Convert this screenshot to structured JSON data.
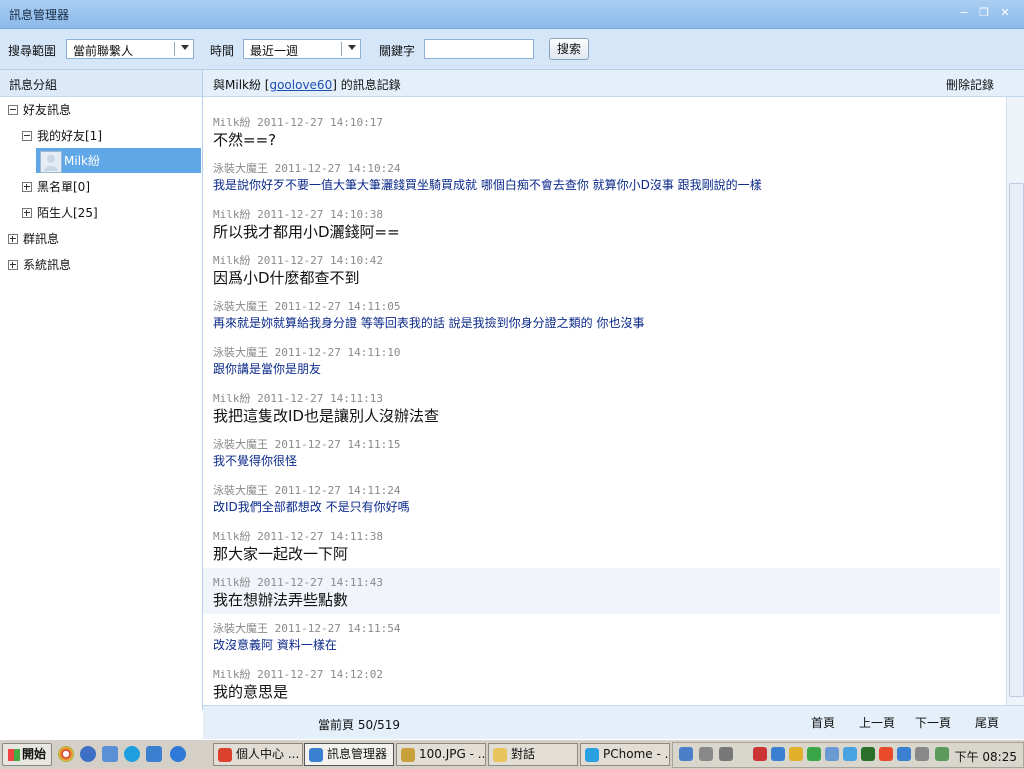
{
  "window": {
    "title": "訊息管理器",
    "minimize_glyph": "−",
    "restore_glyph": "❐",
    "close_glyph": "✕"
  },
  "toolbar": {
    "scope_label": "搜尋範圍",
    "scope_value": "當前聯繫人",
    "time_label": "時間",
    "time_value": "最近一週",
    "keyword_label": "關鍵字",
    "keyword_value": "",
    "search_button": "搜索"
  },
  "sidebar": {
    "header": "訊息分組",
    "items": [
      {
        "label": "好友訊息",
        "expanded": true
      },
      {
        "label": "我的好友[1]",
        "expanded": true
      },
      {
        "label": "Milk紛",
        "selected": true
      },
      {
        "label": "黑名單[0]",
        "expanded": false
      },
      {
        "label": "陌生人[25]",
        "expanded": false
      },
      {
        "label": "群訊息",
        "expanded": false
      },
      {
        "label": "系統訊息",
        "expanded": false
      }
    ]
  },
  "main": {
    "header_prefix": "與Milk紛 [",
    "header_link": "goolove60",
    "header_suffix": "] 的訊息記錄",
    "delete_label": "刪除記錄"
  },
  "messages": [
    {
      "sender": "Milk紛",
      "time": "2011-12-27 14:10:17",
      "text": "不然==?",
      "style": "big"
    },
    {
      "sender": "泳裝大魔王",
      "time": "2011-12-27 14:10:24",
      "text": "我是說你好歹不要一值大筆大筆灑錢買坐騎買成就 哪個白痴不會去查你 就算你小D沒事 跟我剛說的一樣",
      "style": "small"
    },
    {
      "sender": "Milk紛",
      "time": "2011-12-27 14:10:38",
      "text": "所以我才都用小D灑錢阿==",
      "style": "big"
    },
    {
      "sender": "Milk紛",
      "time": "2011-12-27 14:10:42",
      "text": "因爲小D什麽都查不到",
      "style": "big"
    },
    {
      "sender": "泳裝大魔王",
      "time": "2011-12-27 14:11:05",
      "text": "再來就是妳就算給我身分證 等等回表我的話 說是我撿到你身分證之類的 你也沒事",
      "style": "small"
    },
    {
      "sender": "泳裝大魔王",
      "time": "2011-12-27 14:11:10",
      "text": "跟你講是當你是朋友",
      "style": "small"
    },
    {
      "sender": "Milk紛",
      "time": "2011-12-27 14:11:13",
      "text": "我把這隻改ID也是讓別人沒辦法查",
      "style": "big"
    },
    {
      "sender": "泳裝大魔王",
      "time": "2011-12-27 14:11:15",
      "text": "我不覺得你很怪",
      "style": "small"
    },
    {
      "sender": "泳裝大魔王",
      "time": "2011-12-27 14:11:24",
      "text": "改ID我們全部都想改 不是只有你好嗎",
      "style": "small"
    },
    {
      "sender": "Milk紛",
      "time": "2011-12-27 14:11:38",
      "text": "那大家一起改一下阿",
      "style": "big"
    },
    {
      "sender": "Milk紛",
      "time": "2011-12-27 14:11:43",
      "text": "我在想辦法弄些點數",
      "style": "big"
    },
    {
      "sender": "泳裝大魔王",
      "time": "2011-12-27 14:11:54",
      "text": "改沒意義阿 資料一樣在",
      "style": "small"
    },
    {
      "sender": "Milk紛",
      "time": "2011-12-27 14:12:02",
      "text": "我的意思是",
      "style": "big"
    }
  ],
  "footer": {
    "page_info": "當前頁 50/519",
    "first": "首頁",
    "prev": "上一頁",
    "next": "下一頁",
    "last": "尾頁"
  },
  "taskbar": {
    "start": "開始",
    "tasks": [
      {
        "label": "個人中心 ...",
        "icon": "chrome-icon",
        "color": "#d9412e"
      },
      {
        "label": "訊息管理器",
        "icon": "qq-message-icon",
        "color": "#3a7fd0",
        "active": true
      },
      {
        "label": "100.JPG - ...",
        "icon": "image-viewer-icon",
        "color": "#c9a13b"
      },
      {
        "label": "對話",
        "icon": "folder-icon",
        "color": "#e8c55a"
      },
      {
        "label": "PChome - ...",
        "icon": "skype-icon",
        "color": "#2aa0e0"
      }
    ],
    "clock": "下午 08:25"
  }
}
